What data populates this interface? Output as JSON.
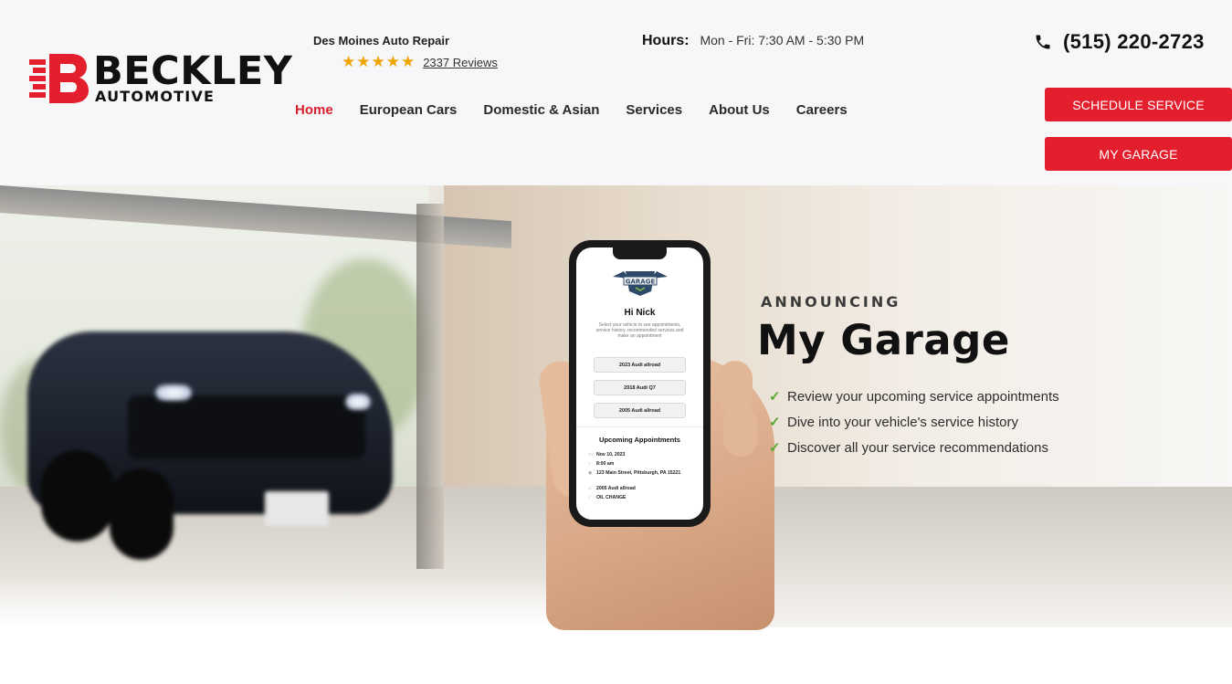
{
  "brand": {
    "name": "BECKLEY",
    "sub": "AUTOMOTIVE",
    "accent_color": "#e31e2d"
  },
  "header": {
    "tagline": "Des Moines Auto Repair",
    "rating": {
      "stars": "★★★★★",
      "star_count": 5,
      "star_color": "#f0a500",
      "reviews_label": "2337 Reviews"
    },
    "hours_label": "Hours:",
    "hours_value": "Mon - Fri: 7:30 AM - 5:30 PM",
    "phone": "(515) 220-2723",
    "phone_icon": "phone-icon"
  },
  "nav": {
    "items": [
      {
        "label": "Home",
        "active": true
      },
      {
        "label": "European Cars",
        "active": false
      },
      {
        "label": "Domestic & Asian",
        "active": false
      },
      {
        "label": "Services",
        "active": false
      },
      {
        "label": "About Us",
        "active": false
      },
      {
        "label": "Careers",
        "active": false
      }
    ]
  },
  "buttons": {
    "schedule": "SCHEDULE SERVICE",
    "garage": "MY GARAGE"
  },
  "hero": {
    "eyebrow": "ANNOUNCING",
    "title": "My Garage",
    "features": [
      "Review your upcoming service appointments",
      "Dive into your vehicle's service history",
      "Discover all your service recommendations"
    ],
    "check_icon": "check-icon",
    "check_color": "#5aa832"
  },
  "phone_screen": {
    "logo_text": "GARAGE",
    "greeting": "Hi Nick",
    "description": "Select your vehicle to see appointments, service history, recommended services and make an appointment",
    "vehicles": [
      "2023 Audi allroad",
      "2018 Audi Q7",
      "2005 Audi allroad"
    ],
    "upcoming_title": "Upcoming Appointments",
    "appointment": {
      "date": "Nov 10, 2023",
      "time": "8:00 am",
      "address": "123 Main Street, Pittsburgh, PA 15221",
      "vehicle": "2005 Audi allroad",
      "service": "OIL CHANGE"
    }
  }
}
